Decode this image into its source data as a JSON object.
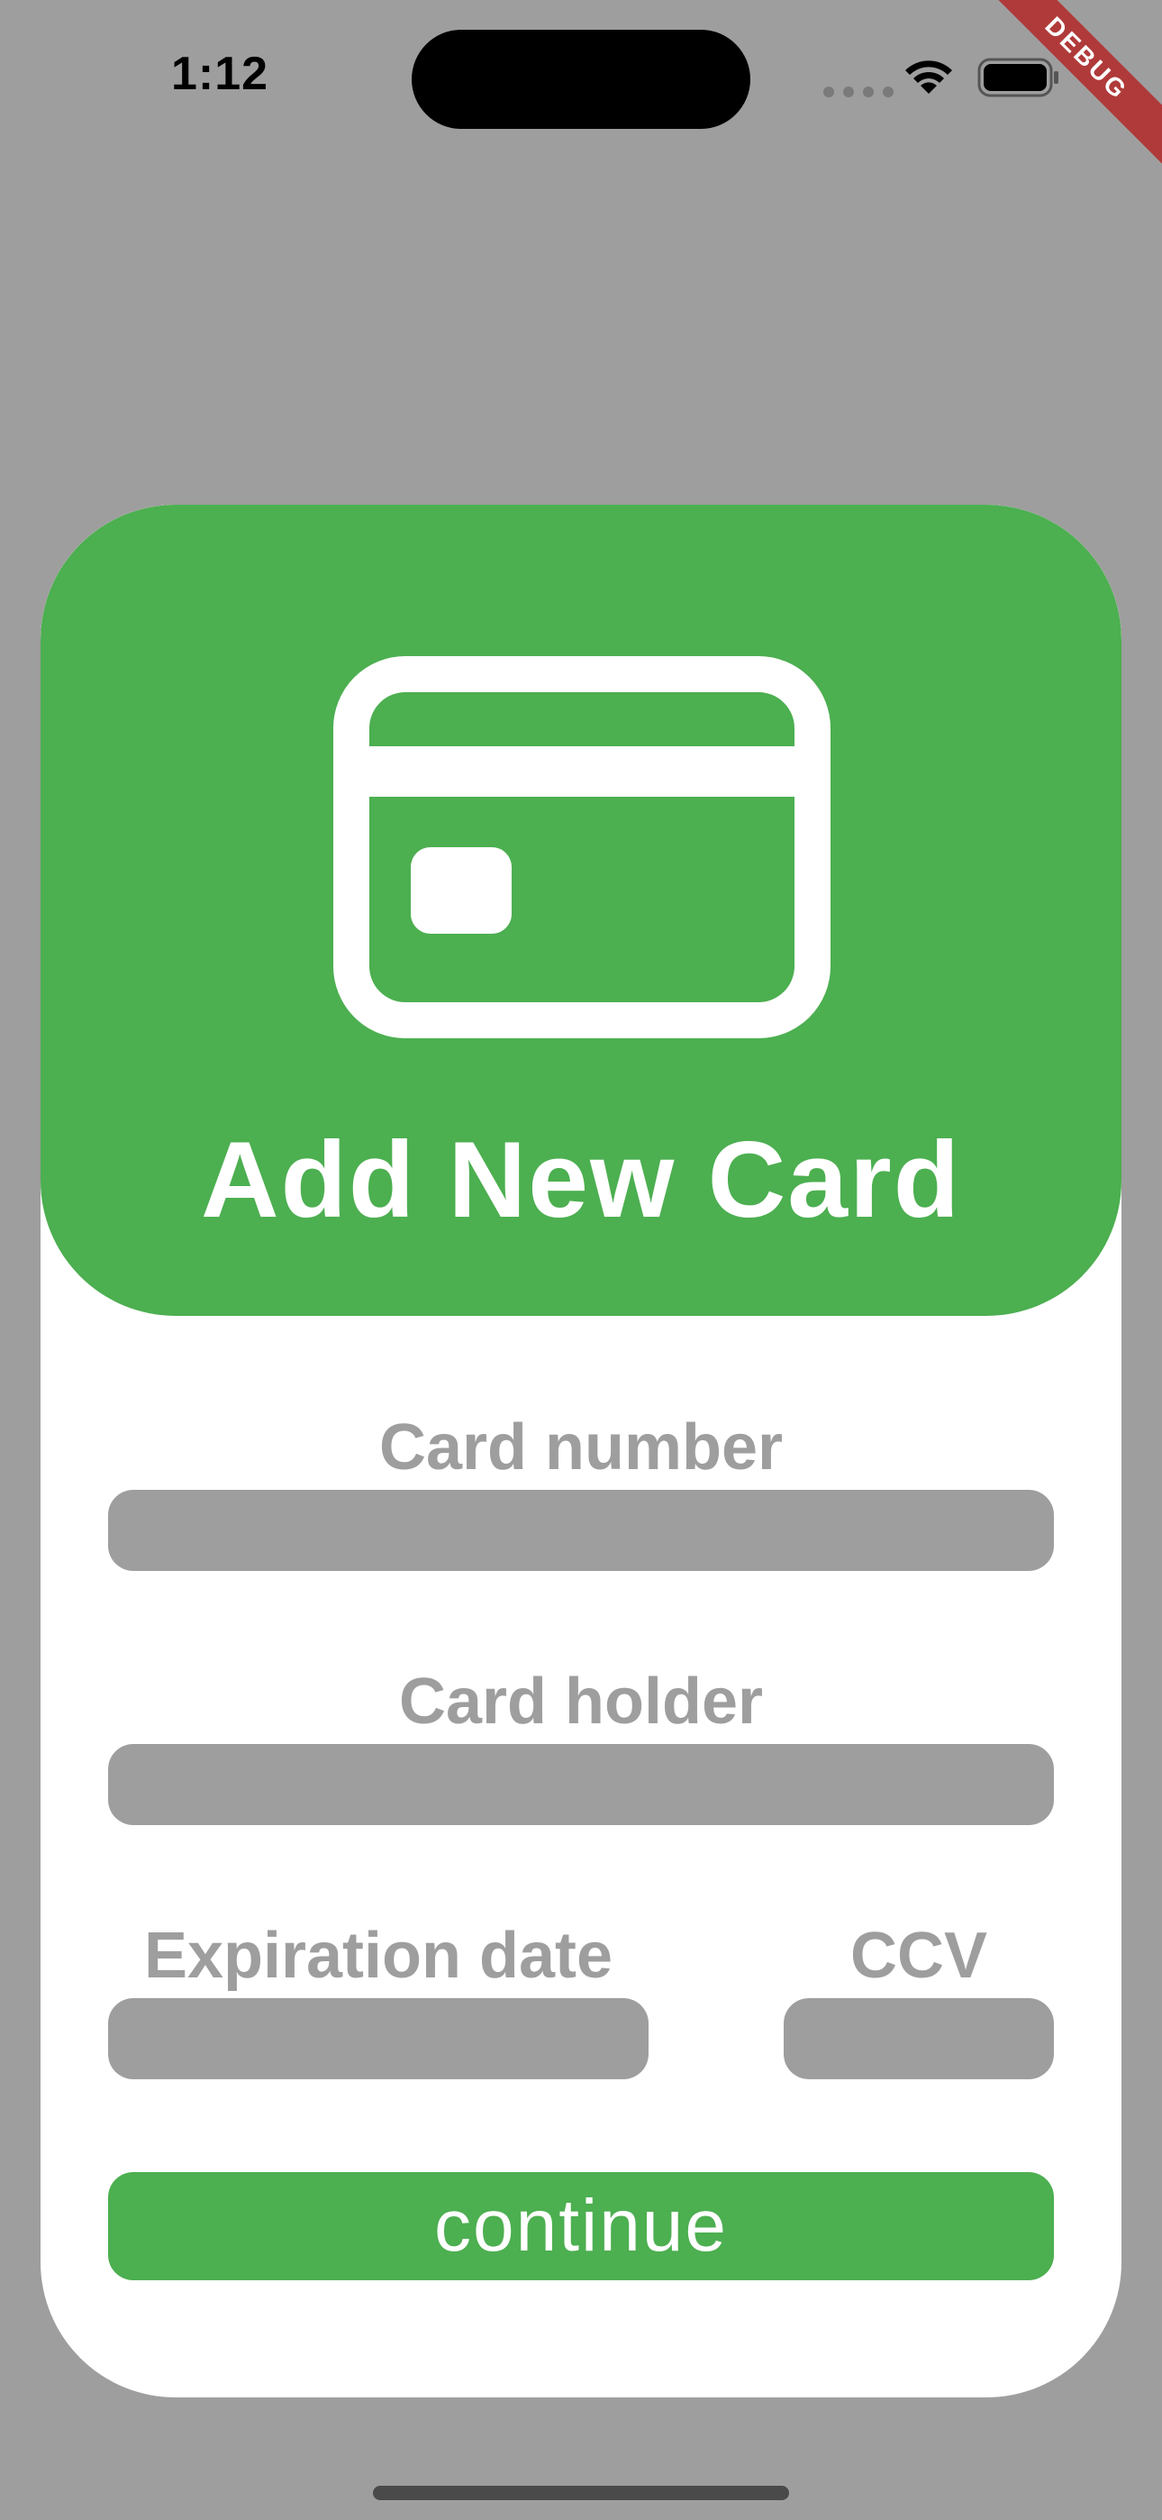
{
  "status_bar": {
    "time": "1:12",
    "wifi_icon": "wifi-icon",
    "battery_icon": "battery-icon"
  },
  "debug_banner": "DEBUG",
  "header": {
    "icon": "credit-card-icon",
    "title": "Add New Card"
  },
  "form": {
    "card_number_label": "Card number",
    "card_number_value": "",
    "card_holder_label": "Card holder",
    "card_holder_value": "",
    "expiration_label": "Expiration date",
    "expiration_value": "",
    "ccv_label": "CCV",
    "ccv_value": ""
  },
  "actions": {
    "continue_label": "continue"
  },
  "colors": {
    "background": "#9e9e9e",
    "accent": "#4caf50",
    "panel": "#ffffff",
    "field": "#9e9e9e",
    "debug_ribbon": "#b03a3a"
  }
}
